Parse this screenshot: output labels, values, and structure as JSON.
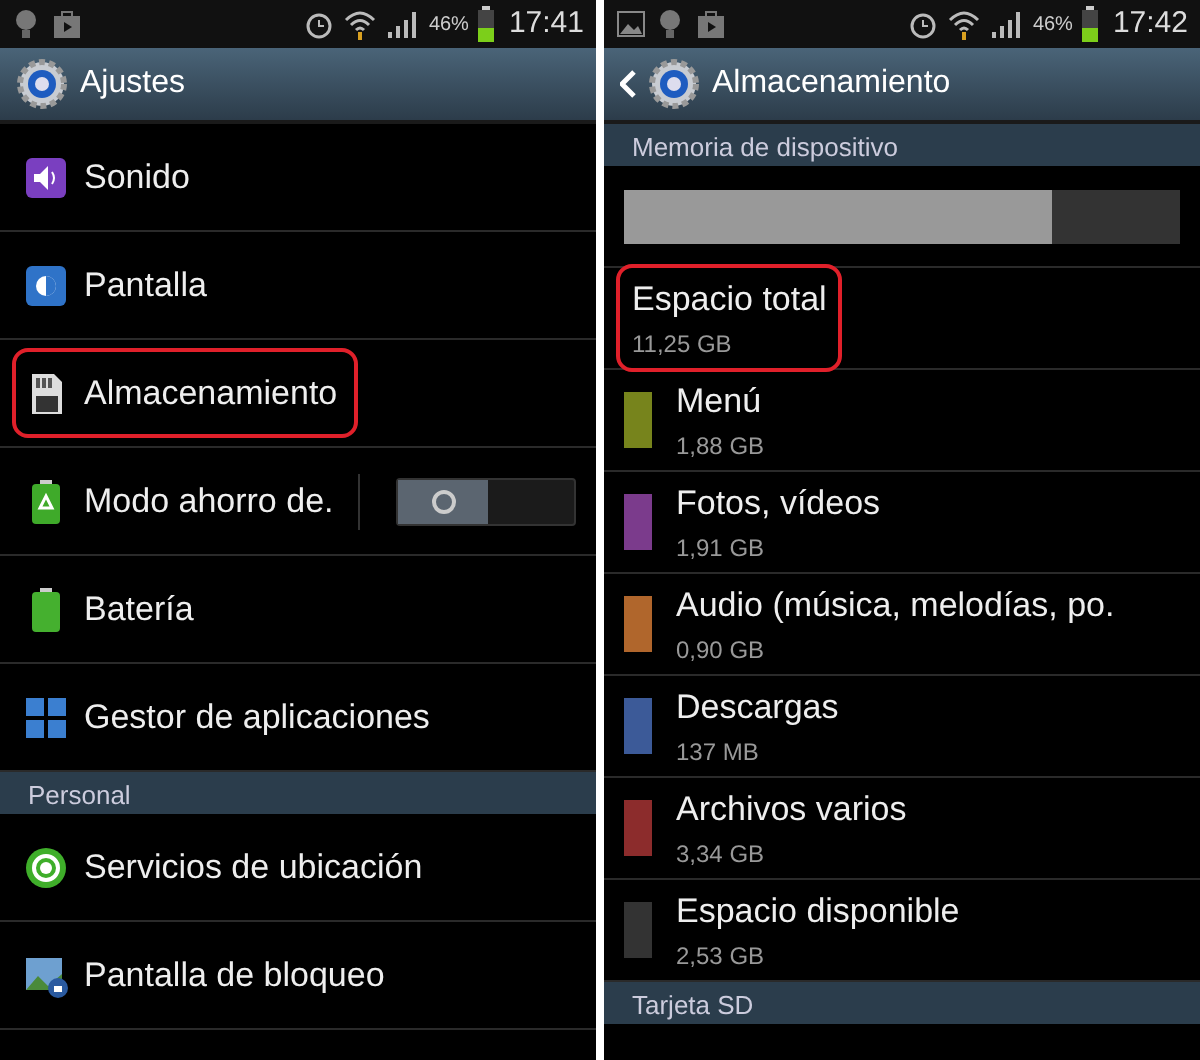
{
  "screens": [
    {
      "status_bar": {
        "battery_text": "46%",
        "time": "17:41"
      },
      "title_bar": {
        "title": "Ajustes",
        "back": false
      },
      "sections": [
        {
          "items": [
            {
              "kind": "setting",
              "label": "Sonido",
              "highlighted": false
            },
            {
              "kind": "setting",
              "label": "Pantalla",
              "highlighted": false
            },
            {
              "kind": "setting",
              "label": "Almacenamiento",
              "highlighted": true
            },
            {
              "kind": "toggle",
              "label": "Modo ahorro de.",
              "on": false,
              "highlighted": false
            },
            {
              "kind": "setting",
              "label": "Batería",
              "highlighted": false
            },
            {
              "kind": "setting",
              "label": "Gestor de aplicaciones",
              "highlighted": false
            }
          ]
        },
        {
          "header": "Personal",
          "items": [
            {
              "kind": "setting",
              "label": "Servicios de ubicación",
              "highlighted": false
            },
            {
              "kind": "setting",
              "label": "Pantalla de bloqueo",
              "highlighted": false
            }
          ]
        }
      ]
    },
    {
      "status_bar": {
        "battery_text": "46%",
        "time": "17:42"
      },
      "title_bar": {
        "title": "Almacenamiento",
        "back": true
      },
      "sections": [
        {
          "header": "Memoria de dispositivo",
          "items": [
            {
              "kind": "usage_bar",
              "level": 0.77
            },
            {
              "kind": "storage",
              "label": "Espacio total",
              "value": "11,25 GB",
              "highlighted": true
            },
            {
              "kind": "storage",
              "label": "Menú",
              "value": "1,88 GB",
              "color": "#77841c",
              "highlighted": false
            },
            {
              "kind": "storage",
              "label": "Fotos, vídeos",
              "value": "1,91 GB",
              "color": "#7b3b8c",
              "highlighted": false
            },
            {
              "kind": "storage",
              "label": "Audio (música, melodías, po.",
              "value": "0,90 GB",
              "color": "#b0662c",
              "highlighted": false
            },
            {
              "kind": "storage",
              "label": "Descargas",
              "value": "137 MB",
              "color": "#3c5a98",
              "highlighted": false
            },
            {
              "kind": "storage",
              "label": "Archivos varios",
              "value": "3,34 GB",
              "color": "#8c2c2c",
              "highlighted": false
            },
            {
              "kind": "storage",
              "label": "Espacio disponible",
              "value": "2,53 GB",
              "color": "#333333",
              "highlighted": false
            }
          ]
        },
        {
          "header": "Tarjeta SD"
        }
      ]
    }
  ]
}
